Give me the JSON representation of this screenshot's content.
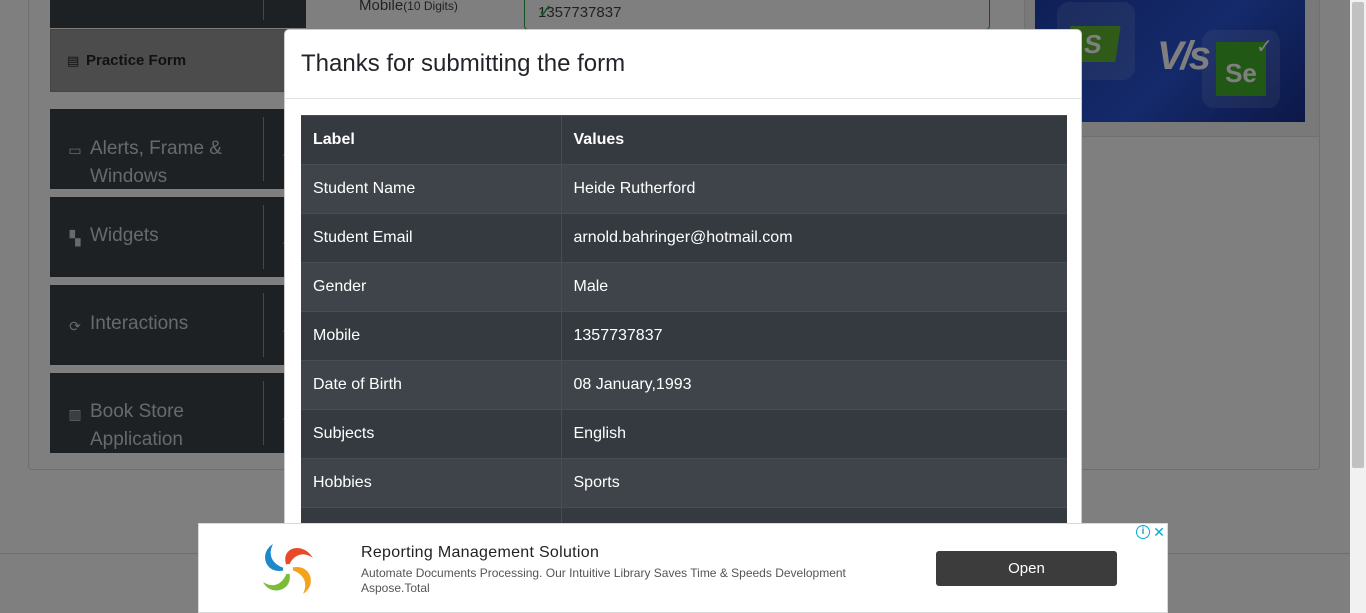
{
  "background": {
    "mobile_label": "Mobile",
    "mobile_hint": "(10 Digits)",
    "mobile_value": "1357737837",
    "practice_form_label": "Practice Form",
    "sidebar_groups": [
      {
        "label_line1": "Alerts, Frame &",
        "label_line2": "Windows",
        "icon": "window-icon"
      },
      {
        "label_line1": "Widgets",
        "label_line2": "",
        "icon": "widgets-icon"
      },
      {
        "label_line1": "Interactions",
        "label_line2": "",
        "icon": "interactions-icon"
      },
      {
        "label_line1": "Book Store",
        "label_line2": "Application",
        "icon": "books-icon"
      }
    ],
    "banner": {
      "left_logo": "S",
      "versus": "V/s",
      "right_logo": "Se"
    }
  },
  "modal": {
    "title": "Thanks for submitting the form",
    "table": {
      "headers": [
        "Label",
        "Values"
      ],
      "rows": [
        {
          "label": "Student Name",
          "value": "Heide Rutherford"
        },
        {
          "label": "Student Email",
          "value": "arnold.bahringer@hotmail.com"
        },
        {
          "label": "Gender",
          "value": "Male"
        },
        {
          "label": "Mobile",
          "value": "1357737837"
        },
        {
          "label": "Date of Birth",
          "value": "08 January,1993"
        },
        {
          "label": "Subjects",
          "value": "English"
        },
        {
          "label": "Hobbies",
          "value": "Sports"
        },
        {
          "label": "",
          "value": ""
        }
      ]
    }
  },
  "ad": {
    "title": "Reporting Management Solution",
    "description": "Automate Documents Processing. Our Intuitive Library Saves Time & Speeds Development",
    "brand": "Aspose.Total",
    "button_label": "Open",
    "info_glyph": "i",
    "close_glyph": "✕"
  },
  "colors": {
    "table_bg": "#343a40",
    "table_stripe": "#3e444a",
    "success": "#28a745",
    "sidebar_bg": "#3c4247"
  }
}
